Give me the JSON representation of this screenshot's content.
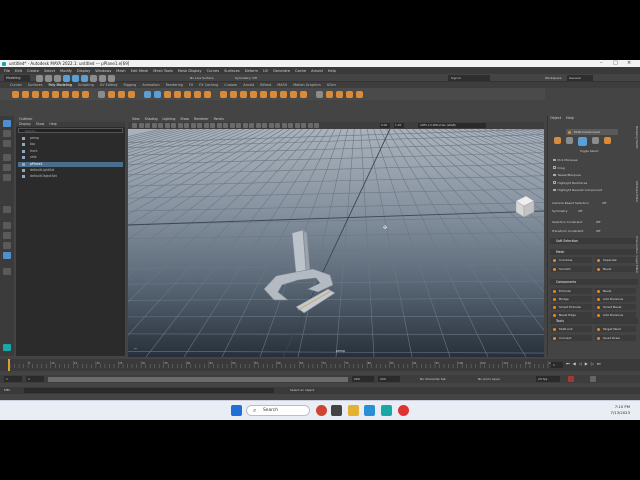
{
  "window": {
    "title": "untitled* - Autodesk MAYA 2022.1: untitled --- pPlane1.e[69]"
  },
  "menu": [
    "File",
    "Edit",
    "Create",
    "Select",
    "Modify",
    "Display",
    "Windows",
    "Mesh",
    "Edit Mesh",
    "Mesh Tools",
    "Mesh Display",
    "Curves",
    "Surfaces",
    "Deform",
    "UV",
    "Generate",
    "Cache",
    "Arnold",
    "Help"
  ],
  "status": {
    "mode": "Modeling",
    "symmetry": "Symmetry: Off",
    "no_live": "No Live Surface",
    "sign_in": "Sign In",
    "workspace_label": "Workspace:",
    "workspace_value": "General"
  },
  "shelf_tabs": [
    "Curves",
    "Surfaces",
    "Poly Modeling",
    "Sculpting",
    "UV Editing",
    "Rigging",
    "Animation",
    "Rendering",
    "FX",
    "FX Caching",
    "Custom",
    "Arnold",
    "Bifrost",
    "MASH",
    "Motion Graphics",
    "XGen"
  ],
  "outliner": {
    "title": "Outliner",
    "menu": [
      "Display",
      "Show",
      "Help"
    ],
    "search_placeholder": "Search...",
    "items": [
      {
        "label": "persp",
        "selected": false
      },
      {
        "label": "top",
        "selected": false
      },
      {
        "label": "front",
        "selected": false
      },
      {
        "label": "side",
        "selected": false
      },
      {
        "label": "pPlane1",
        "selected": true
      },
      {
        "label": "defaultLightSet",
        "selected": false
      },
      {
        "label": "defaultObjectSet",
        "selected": false
      }
    ]
  },
  "viewport": {
    "menu": [
      "View",
      "Shading",
      "Lighting",
      "Show",
      "Renderer",
      "Panels"
    ],
    "camera_label": "persp",
    "color_space": "ACES 1.0 SDR-video (sRGB)",
    "value_a": "0.00",
    "value_b": "1.00"
  },
  "attribute": {
    "tabs": [
      "Object",
      "Help"
    ],
    "multi_component": "Multi-Component",
    "toggle_select": "Toggle Select",
    "checks": [
      "Pick Marquee",
      "Drag",
      "Tweak/Marquee",
      "Highlight Backfaces",
      "Highlight Nearest Component"
    ],
    "camera_based": "Camera Based Selection",
    "camera_based_state": "Off",
    "symmetry_label": "Symmetry",
    "symmetry_state": "Off",
    "selection_constraint": "Selection Constraint",
    "selection_constraint_state": "Off",
    "transform_constraint": "Transform Constraint",
    "transform_constraint_state": "Off",
    "soft_selection": "Soft Selection",
    "sections": {
      "mesh": "Mesh",
      "components": "Components",
      "tools": "Tools"
    },
    "mesh_buttons": [
      "Combine",
      "Separate",
      "Smooth",
      "Bevel"
    ],
    "component_buttons": [
      "Extrude",
      "Bevel",
      "Bridge",
      "Add Divisions",
      "Smart Extrude",
      "Smart Bevel",
      "Bevel Edge",
      "Add Divisions"
    ],
    "tool_buttons": [
      "Multi-Cut",
      "Target Weld",
      "Connect",
      "Quad Draw"
    ],
    "side_tabs": [
      "Modeling Toolkit",
      "Attribute Editor",
      "Channel Box / Layer Editor"
    ]
  },
  "timeline": {
    "ticks": [
      "5",
      "10",
      "15",
      "20",
      "25",
      "30",
      "35",
      "40",
      "45",
      "50",
      "55",
      "60",
      "65",
      "70",
      "75",
      "80",
      "85",
      "90",
      "95",
      "100",
      "105",
      "110",
      "115",
      "120"
    ],
    "current_frame": "1",
    "start": "1",
    "start_b": "1",
    "end": "200",
    "end_b": "200",
    "fps": "24 fps",
    "anim_layer": "No Anim Layer",
    "char_set": "No Character Set"
  },
  "cmdline": {
    "label": "MEL",
    "help": "Select an object"
  },
  "taskbar": {
    "search_placeholder": "Search",
    "time": "7:10 PM",
    "date": "7/13/2023"
  }
}
